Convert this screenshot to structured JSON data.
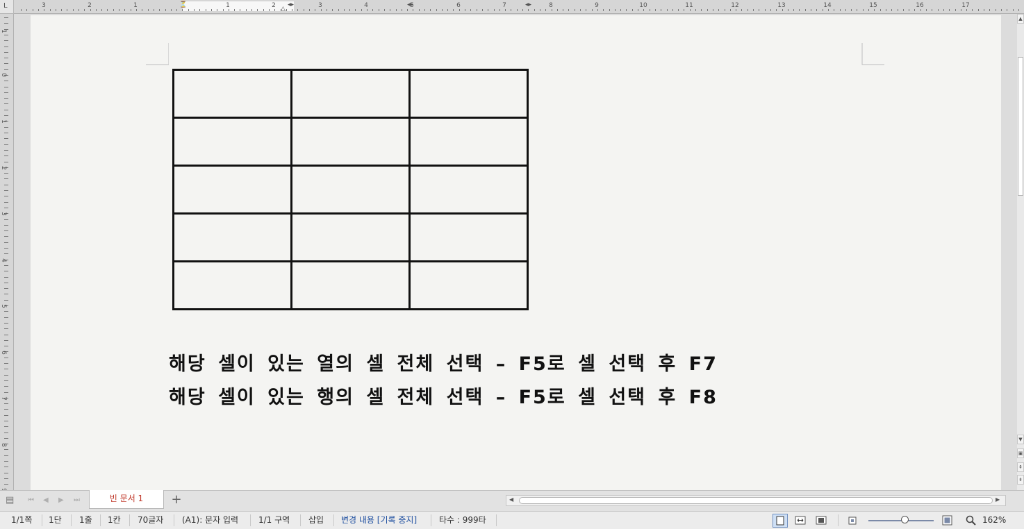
{
  "ruler": {
    "corner_glyph": "L",
    "horizontal_numbers": [
      "3",
      "2",
      "1",
      "1",
      "2",
      "3",
      "4",
      "5",
      "6",
      "7",
      "8",
      "9",
      "10",
      "11",
      "12",
      "13",
      "14",
      "15",
      "16",
      "17"
    ],
    "vertical_numbers": [
      "1",
      "0",
      "1",
      "2",
      "3",
      "4",
      "5",
      "6",
      "7",
      "8",
      "9"
    ]
  },
  "document": {
    "table": {
      "rows": 5,
      "cols": 3
    },
    "lines": [
      "해당 셀이 있는 열의 셀 전체 선택 – F5로 셀 선택 후 F7",
      "해당 셀이 있는 행의 셀 전체 선택 – F5로 셀 선택 후 F8"
    ]
  },
  "tabs": {
    "active_label": "빈 문서 1",
    "add_label": "+"
  },
  "status": {
    "page": "1/1쪽",
    "column": "1단",
    "line": "1줄",
    "char_col": "1칸",
    "char_count": "70글자",
    "mode": "(A1): 문자 입력",
    "section": "1/1 구역",
    "insert": "삽입",
    "track_changes": "변경 내용 [기록 중지]",
    "typing_speed": "타수 : 999타",
    "zoom": "162%"
  },
  "colors": {
    "tab_text": "#c0392b",
    "track_changes_text": "#1f4fa0",
    "page_bg": "#f4f4f2"
  }
}
